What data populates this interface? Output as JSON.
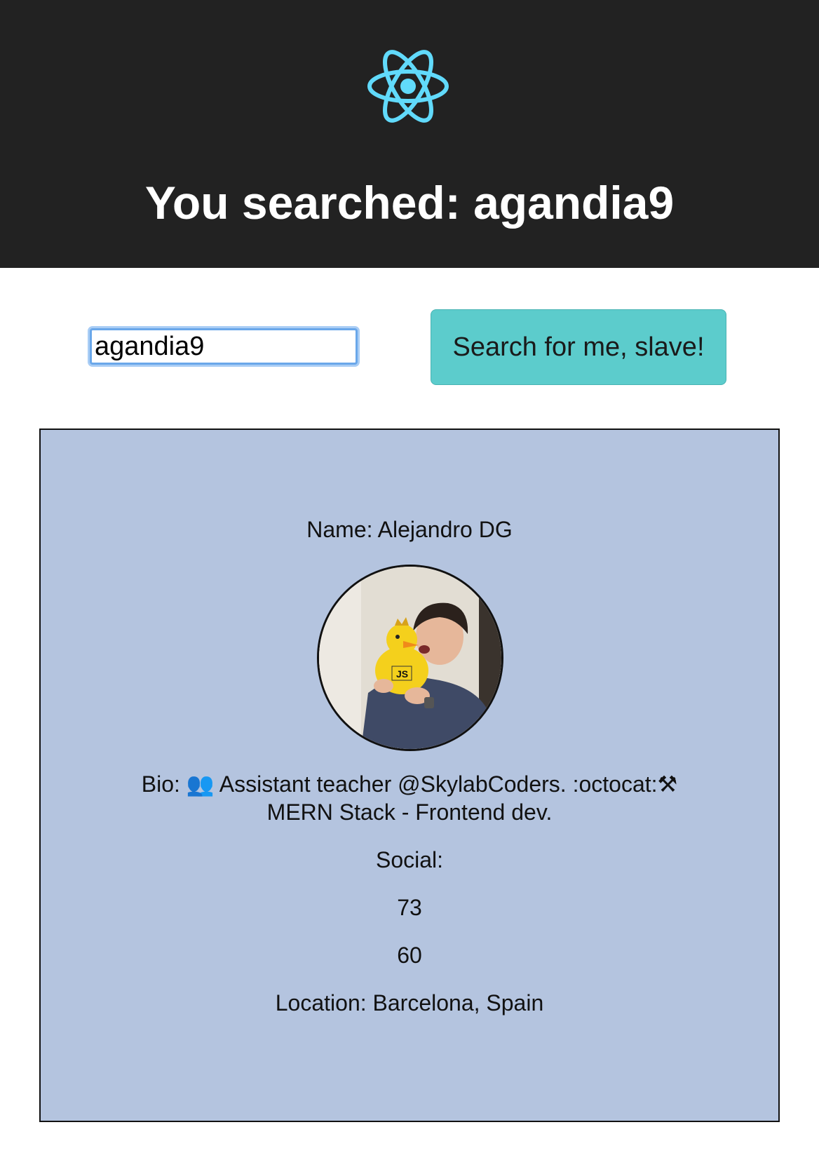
{
  "header": {
    "logo_icon": "react-atom-icon",
    "logo_color": "#61dafb",
    "title": "You searched: agandia9"
  },
  "search": {
    "value": "agandia9",
    "button_label": "Search for me, slave!",
    "button_color": "#5ccccc"
  },
  "profile": {
    "card_color": "#b4c4df",
    "name": "Name: Alejandro DG",
    "avatar_alt": "avatar",
    "bio_line1": "Bio: 👥  Assistant teacher @SkylabCoders.   :octocat:⚒",
    "bio_line2": "MERN Stack - Frontend dev.",
    "social_label": "Social:",
    "followers": "73",
    "following": "60",
    "location": "Location: Barcelona, Spain"
  }
}
